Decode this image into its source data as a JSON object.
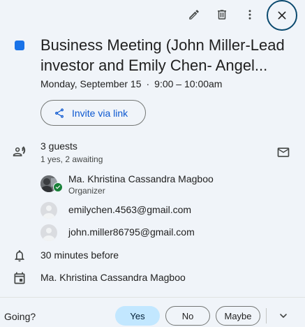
{
  "toolbar": {
    "edit_icon": "pencil-icon",
    "delete_icon": "trash-icon",
    "more_icon": "more-vert-icon",
    "close_icon": "close-icon"
  },
  "event": {
    "color": "#1a73e8",
    "title_line1": "Business Meeting (John Miller-Lead",
    "title_line2": "investor and Emily Chen- Angel...",
    "date": "Monday, September 15",
    "separator": "·",
    "time": "9:00 – 10:00am"
  },
  "invite": {
    "label": "Invite via link",
    "icon": "share-icon"
  },
  "guests": {
    "count": "3 guests",
    "summary": "1 yes, 2 awaiting",
    "list": [
      {
        "name": "Ma. Khristina Cassandra Magboo",
        "role": "Organizer"
      },
      {
        "name": "emilychen.4563@gmail.com"
      },
      {
        "name": "john.miller86795@gmail.com"
      }
    ]
  },
  "reminder": "30 minutes before",
  "calendar_owner": "Ma. Khristina Cassandra Magboo",
  "footer": {
    "question": "Going?",
    "yes": "Yes",
    "no": "No",
    "maybe": "Maybe",
    "yes_color": "#c2e7ff"
  }
}
